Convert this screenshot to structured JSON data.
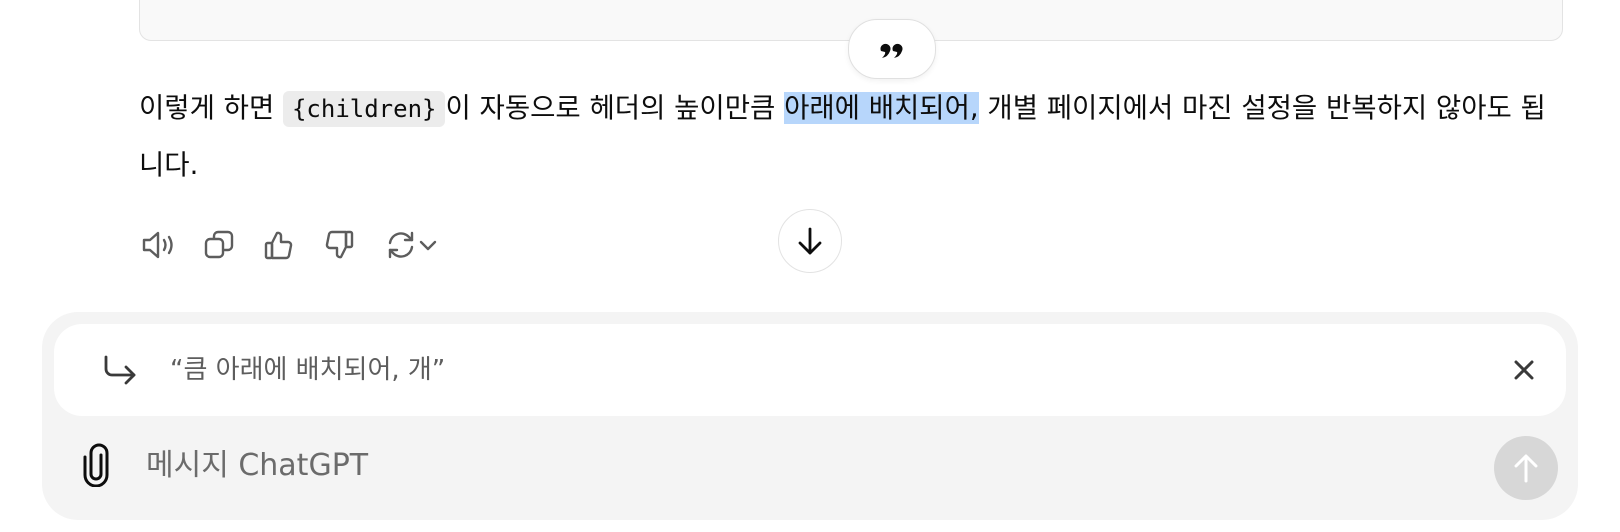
{
  "answer": {
    "text_before_code": "이렇게 하면 ",
    "code": "{children}",
    "text_mid": "이 자동으로 헤더의 높이만큼 ",
    "highlight": "아래에 배치되어,",
    "text_after": " 개별 페이지에서 마진 설정을 반복하지 않아도 됩니다."
  },
  "quote_button": {
    "icon": "quote-icon"
  },
  "actions": [
    {
      "name": "read-aloud-button",
      "icon": "speaker-icon"
    },
    {
      "name": "copy-button",
      "icon": "copy-icon"
    },
    {
      "name": "thumbs-up-button",
      "icon": "thumbs-up-icon"
    },
    {
      "name": "thumbs-down-button",
      "icon": "thumbs-down-icon"
    },
    {
      "name": "regenerate-button",
      "icon": "refresh-icon"
    }
  ],
  "scroll_down": {
    "icon": "arrow-down-icon"
  },
  "composer": {
    "quoted_text": "“큼 아래에 배치되어, 개”",
    "placeholder": "메시지 ChatGPT"
  },
  "colors": {
    "highlight": "#b7d6fb",
    "composer_bg": "#f4f4f4",
    "send_disabled": "#d7d7d7"
  }
}
